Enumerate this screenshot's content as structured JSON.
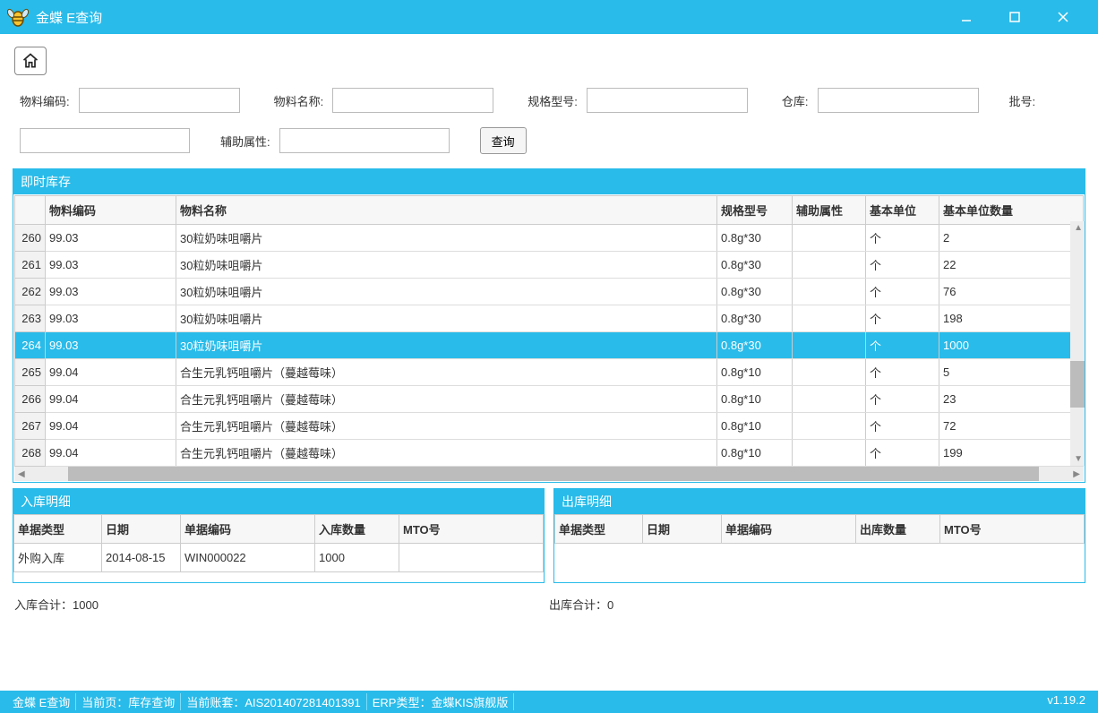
{
  "app": {
    "title": "金蝶 E查询"
  },
  "filters": {
    "material_code_label": "物料编码:",
    "material_name_label": "物料名称:",
    "spec_label": "规格型号:",
    "warehouse_label": "仓库:",
    "batch_label": "批号:",
    "aux_attr_label": "辅助属性:",
    "query_btn": "查询",
    "material_code": "",
    "material_name": "",
    "spec": "",
    "warehouse": "",
    "batch_no": "",
    "aux_attr": ""
  },
  "inventory": {
    "title": "即时库存",
    "columns": {
      "code": "物料编码",
      "name": "物料名称",
      "spec": "规格型号",
      "aux": "辅助属性",
      "unit": "基本单位",
      "qty": "基本单位数量"
    },
    "rows": [
      {
        "n": "260",
        "code": "99.03",
        "name": "30粒奶味咀嚼片",
        "spec": "0.8g*30",
        "aux": "",
        "unit": "个",
        "qty": "2",
        "sel": false
      },
      {
        "n": "261",
        "code": "99.03",
        "name": "30粒奶味咀嚼片",
        "spec": "0.8g*30",
        "aux": "",
        "unit": "个",
        "qty": "22",
        "sel": false
      },
      {
        "n": "262",
        "code": "99.03",
        "name": "30粒奶味咀嚼片",
        "spec": "0.8g*30",
        "aux": "",
        "unit": "个",
        "qty": "76",
        "sel": false
      },
      {
        "n": "263",
        "code": "99.03",
        "name": "30粒奶味咀嚼片",
        "spec": "0.8g*30",
        "aux": "",
        "unit": "个",
        "qty": "198",
        "sel": false
      },
      {
        "n": "264",
        "code": "99.03",
        "name": "30粒奶味咀嚼片",
        "spec": "0.8g*30",
        "aux": "",
        "unit": "个",
        "qty": "1000",
        "sel": true
      },
      {
        "n": "265",
        "code": "99.04",
        "name": "合生元乳钙咀嚼片（蔓越莓味）",
        "spec": "0.8g*10",
        "aux": "",
        "unit": "个",
        "qty": "5",
        "sel": false
      },
      {
        "n": "266",
        "code": "99.04",
        "name": "合生元乳钙咀嚼片（蔓越莓味）",
        "spec": "0.8g*10",
        "aux": "",
        "unit": "个",
        "qty": "23",
        "sel": false
      },
      {
        "n": "267",
        "code": "99.04",
        "name": "合生元乳钙咀嚼片（蔓越莓味）",
        "spec": "0.8g*10",
        "aux": "",
        "unit": "个",
        "qty": "72",
        "sel": false
      },
      {
        "n": "268",
        "code": "99.04",
        "name": "合生元乳钙咀嚼片（蔓越莓味）",
        "spec": "0.8g*10",
        "aux": "",
        "unit": "个",
        "qty": "199",
        "sel": false
      }
    ]
  },
  "inbound": {
    "title": "入库明细",
    "columns": {
      "type": "单据类型",
      "date": "日期",
      "code": "单据编码",
      "qty": "入库数量",
      "mto": "MTO号"
    },
    "rows": [
      {
        "type": "外购入库",
        "date": "2014-08-15",
        "code": "WIN000022",
        "qty": "1000",
        "mto": ""
      }
    ]
  },
  "outbound": {
    "title": "出库明细",
    "columns": {
      "type": "单据类型",
      "date": "日期",
      "code": "单据编码",
      "qty": "出库数量",
      "mto": "MTO号"
    }
  },
  "totals": {
    "in": "入库合计：1000",
    "out": "出库合计：0"
  },
  "status": {
    "app": "金蝶 E查询",
    "page": "当前页：库存查询",
    "account": "当前账套：AIS201407281401391",
    "erp": "ERP类型：金蝶KIS旗舰版",
    "version": "v1.19.2"
  }
}
